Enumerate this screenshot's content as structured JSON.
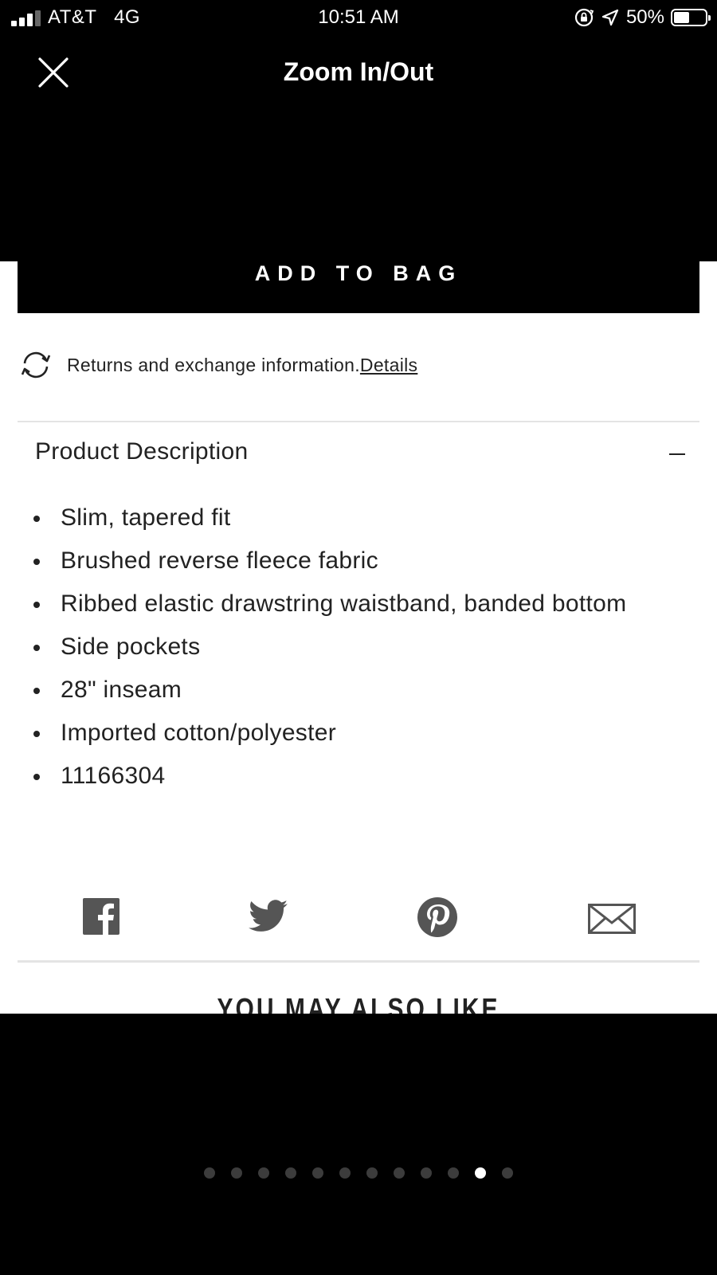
{
  "status_bar": {
    "carrier": "AT&T",
    "network": "4G",
    "time": "10:51 AM",
    "battery_percent": "50%",
    "signal_bars": 3,
    "signal_bars_total": 4,
    "battery_level": 0.5
  },
  "header": {
    "title": "Zoom In/Out",
    "close_icon": "close-icon"
  },
  "product": {
    "add_to_bag_label": "ADD TO BAG",
    "returns_text": "Returns and exchange information.",
    "returns_link": "Details",
    "description_title": "Product Description",
    "description_items": [
      "Slim, tapered fit",
      "Brushed reverse fleece fabric",
      "Ribbed elastic drawstring waistband, banded bottom",
      "Side pockets",
      "28\" inseam",
      "Imported cotton/polyester",
      "11166304"
    ],
    "share_icons": [
      "facebook-icon",
      "twitter-icon",
      "pinterest-icon",
      "email-icon"
    ],
    "also_like_heading": "YOU MAY ALSO LIKE"
  },
  "gallery": {
    "total_images": 12,
    "active_index": 10
  },
  "colors": {
    "background": "#000000",
    "sheet": "#ffffff",
    "text": "#222222",
    "icon_gray": "#555555",
    "dot_inactive": "#3c3c3c",
    "dot_active": "#ffffff"
  }
}
